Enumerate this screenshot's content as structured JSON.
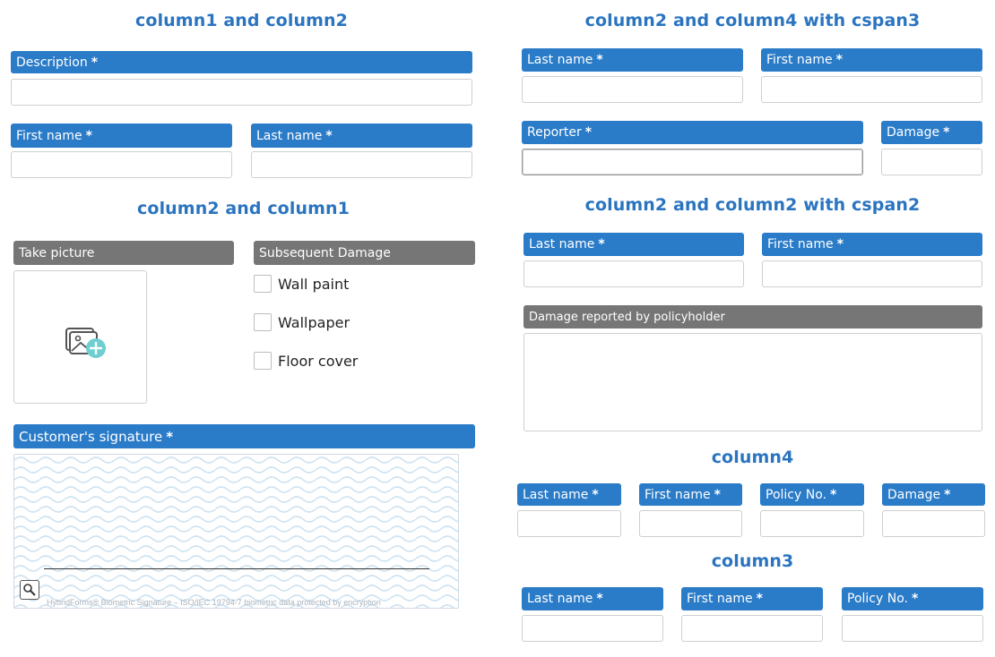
{
  "titles": {
    "col1_col2": "column1 and column2",
    "col2_col1": "column2 and column1",
    "col2_col4_cspan3": "column2 and column4 with cspan3",
    "col2_col2_cspan2": "column2 and column2 with cspan2",
    "column4": "column4",
    "column3": "column3"
  },
  "required_mark": "*",
  "left": {
    "description_label": "Description",
    "first_name_label": "First name",
    "last_name_label": "Last name",
    "take_picture_label": "Take picture",
    "subsequent_damage_label": "Subsequent Damage",
    "checkboxes": [
      "Wall paint",
      "Wallpaper",
      "Floor cover"
    ],
    "signature_label": "Customer's signature",
    "signature_note": "HybridForms® Biometric Signature  –  ISO/IEC 19794-7 biometric data protected by encryption"
  },
  "right": {
    "cspan3": {
      "last_name_label": "Last name",
      "first_name_label": "First name",
      "reporter_label": "Reporter",
      "damage_label": "Damage"
    },
    "cspan2": {
      "last_name_label": "Last name",
      "first_name_label": "First name",
      "damage_reported_label": "Damage reported by policyholder"
    },
    "column4": {
      "last_name_label": "Last name",
      "first_name_label": "First name",
      "policy_label": "Policy No.",
      "damage_label": "Damage"
    },
    "column3": {
      "last_name_label": "Last name",
      "first_name_label": "First name",
      "policy_label": "Policy No."
    }
  },
  "colors": {
    "label_blue": "#2a7bc8",
    "label_gray": "#767676",
    "title_blue": "#2a74c0"
  },
  "icons": [
    "add-picture-icon",
    "magnifier-icon"
  ]
}
